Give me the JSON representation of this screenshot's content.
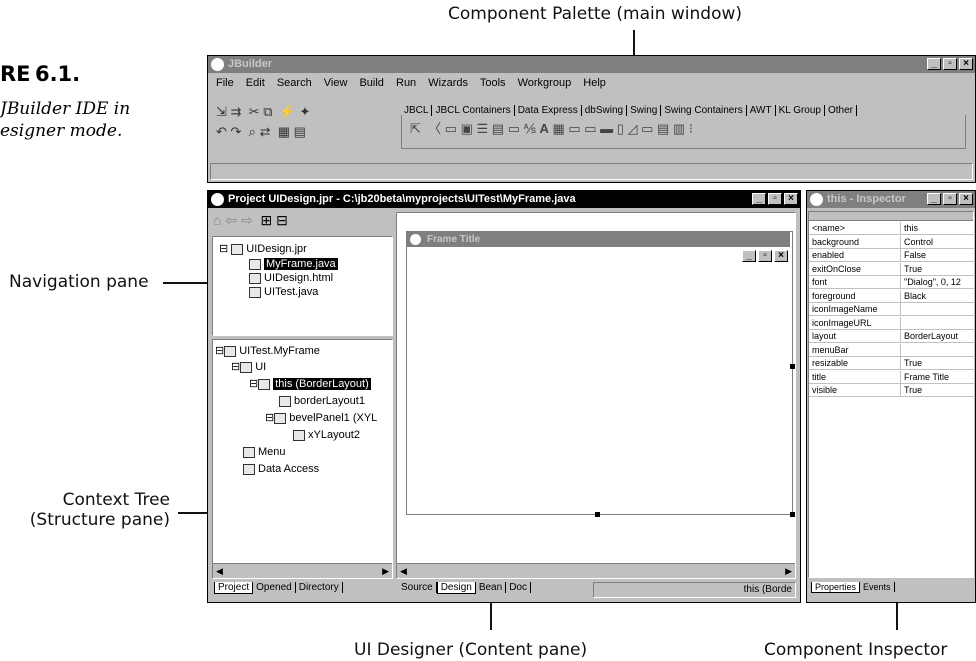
{
  "figure": {
    "label_prefix": "RE",
    "label_number": "6.1.",
    "caption_line1": "JBuilder IDE in",
    "caption_line2": "esigner mode."
  },
  "callouts": {
    "palette": "Component Palette (main window)",
    "navigation": "Navigation pane",
    "context_tree_1": "Context Tree",
    "context_tree_2": "(Structure pane)",
    "designer": "UI Designer (Content pane)",
    "inspector": "Component Inspector"
  },
  "main_window": {
    "title": "JBuilder",
    "menu": [
      "File",
      "Edit",
      "Search",
      "View",
      "Build",
      "Run",
      "Wizards",
      "Tools",
      "Workgroup",
      "Help"
    ],
    "palette_tabs": [
      "JBCL",
      "JBCL Containers",
      "Data Express",
      "dbSwing",
      "Swing",
      "Swing Containers",
      "AWT",
      "KL Group",
      "Other"
    ]
  },
  "project_window": {
    "title": "Project UIDesign.jpr - C:\\jb20beta\\myprojects\\UITest\\MyFrame.java",
    "nav_items": [
      "UIDesign.jpr",
      "MyFrame.java",
      "UIDesign.html",
      "UITest.java"
    ],
    "structure_items": [
      "UITest.MyFrame",
      "UI",
      "this (BorderLayout)",
      "borderLayout1",
      "bevelPanel1 (XYL",
      "xYLayout2",
      "Menu",
      "Data Access"
    ],
    "left_tabs": [
      "Project",
      "Opened",
      "Directory"
    ],
    "content_tabs": [
      "Source",
      "Design",
      "Bean",
      "Doc"
    ],
    "status_text": "this (Borde",
    "frame_title": "Frame Title"
  },
  "inspector": {
    "title": "this - Inspector",
    "properties": [
      {
        "name": "<name>",
        "value": "this"
      },
      {
        "name": "background",
        "value": "Control"
      },
      {
        "name": "enabled",
        "value": "False"
      },
      {
        "name": "exitOnClose",
        "value": "True"
      },
      {
        "name": "font",
        "value": "\"Dialog\", 0, 12"
      },
      {
        "name": "foreground",
        "value": "Black"
      },
      {
        "name": "iconImageName",
        "value": ""
      },
      {
        "name": "iconImageURL",
        "value": ""
      },
      {
        "name": "layout",
        "value": "BorderLayout"
      },
      {
        "name": "menuBar",
        "value": ""
      },
      {
        "name": "resizable",
        "value": "True"
      },
      {
        "name": "title",
        "value": "Frame Title"
      },
      {
        "name": "visible",
        "value": "True"
      }
    ],
    "tabs": [
      "Properties",
      "Events"
    ]
  }
}
